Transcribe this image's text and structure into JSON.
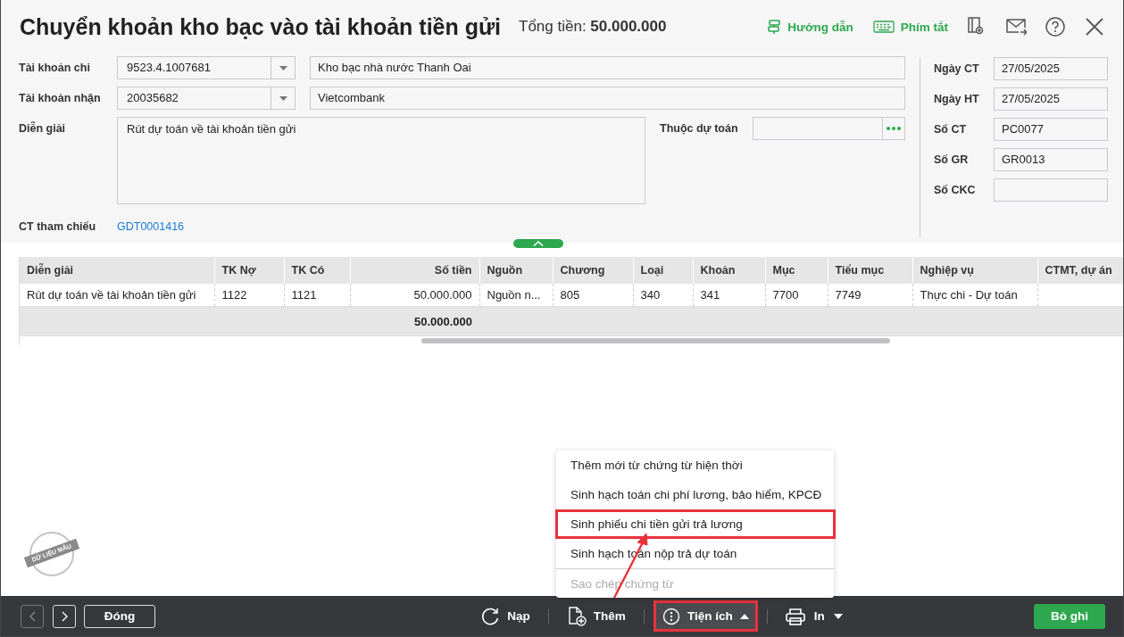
{
  "window": {
    "title": "Chuyển khoản kho bạc vào tài khoản tiền gửi",
    "total_label": "Tổng tiền:",
    "total_value": "50.000.000"
  },
  "header_actions": [
    {
      "kind": "guide",
      "label": "Hướng dẫn"
    },
    {
      "kind": "shortcut",
      "label": "Phím tắt"
    }
  ],
  "account_out": {
    "label": "Tài khoản chi",
    "value": "9523.4.1007681",
    "name": "Kho bạc nhà nước Thanh Oai"
  },
  "account_in": {
    "label": "Tài khoản nhận",
    "value": "20035682",
    "name": "Vietcombank"
  },
  "description": {
    "label": "Diễn giải",
    "value": "Rút dự toán về tài khoản tiền gửi"
  },
  "budget": {
    "label": "Thuộc dự toán"
  },
  "reference": {
    "label": "CT tham chiếu",
    "link": "GDT0001416"
  },
  "side_fields": [
    {
      "label": "Ngày CT",
      "value": "27/05/2025"
    },
    {
      "label": "Ngày HT",
      "value": "27/05/2025"
    },
    {
      "label": "Số CT",
      "value": "PC0077"
    },
    {
      "label": "Số GR",
      "value": "GR0013"
    },
    {
      "label": "Số CKC"
    }
  ],
  "table": {
    "columns": [
      {
        "label": "Diễn giải",
        "kind": "text"
      },
      {
        "label": "TK Nợ",
        "kind": "text"
      },
      {
        "label": "TK Có",
        "kind": "text"
      },
      {
        "label": "Số tiền",
        "kind": "amount"
      },
      {
        "label": "Nguồn",
        "kind": "text"
      },
      {
        "label": "Chương",
        "kind": "text"
      },
      {
        "label": "Loại",
        "kind": "text"
      },
      {
        "label": "Khoản",
        "kind": "text"
      },
      {
        "label": "Mục",
        "kind": "text"
      },
      {
        "label": "Tiểu mục",
        "kind": "text"
      },
      {
        "label": "Nghiệp vụ",
        "kind": "text"
      },
      {
        "label": "CTMT, dự án",
        "kind": "text"
      }
    ],
    "rows": [
      {
        "cells": [
          "Rút dự toán về tài khoản tiền gửi",
          "1122",
          "1121",
          "50.000.000",
          "Nguồn n...",
          "805",
          "340",
          "341",
          "7700",
          "7749",
          "Thực chi - Dự toán"
        ]
      }
    ],
    "total": "50.000.000"
  },
  "sample_stamp": "DỮ LIỆU MẪU",
  "menu": {
    "items": [
      {
        "label": "Thêm mới từ chứng từ hiện thời",
        "disabled": false,
        "highlighted": false
      },
      {
        "label": "Sinh hạch toán chi phí lương, bảo hiểm, KPCĐ",
        "disabled": false,
        "highlighted": false
      },
      {
        "label": "Sinh phiếu chi tiền gửi trả lương",
        "disabled": false,
        "highlighted": true
      },
      {
        "label": "Sinh hạch toán nộp trả dự toán",
        "disabled": false,
        "highlighted": false
      },
      {
        "label": "Sao chép chứng từ",
        "disabled": true,
        "highlighted": false
      }
    ]
  },
  "bottom_bar": {
    "nav_buttons": [
      {
        "kind": "prev",
        "disabled": true
      },
      {
        "kind": "next",
        "disabled": false
      }
    ],
    "close_button": "Đóng",
    "toolbar": [
      {
        "kind": "reload",
        "label": "Nạp",
        "expanded": false,
        "highlighted": false
      },
      {
        "kind": "add",
        "label": "Thêm",
        "expanded": false,
        "highlighted": false
      },
      {
        "kind": "utilities",
        "label": "Tiện ích",
        "expanded": true,
        "highlighted": true
      },
      {
        "kind": "print",
        "label": "In",
        "expanded": false,
        "highlighted": false
      }
    ],
    "save_button": "Bỏ ghi"
  }
}
